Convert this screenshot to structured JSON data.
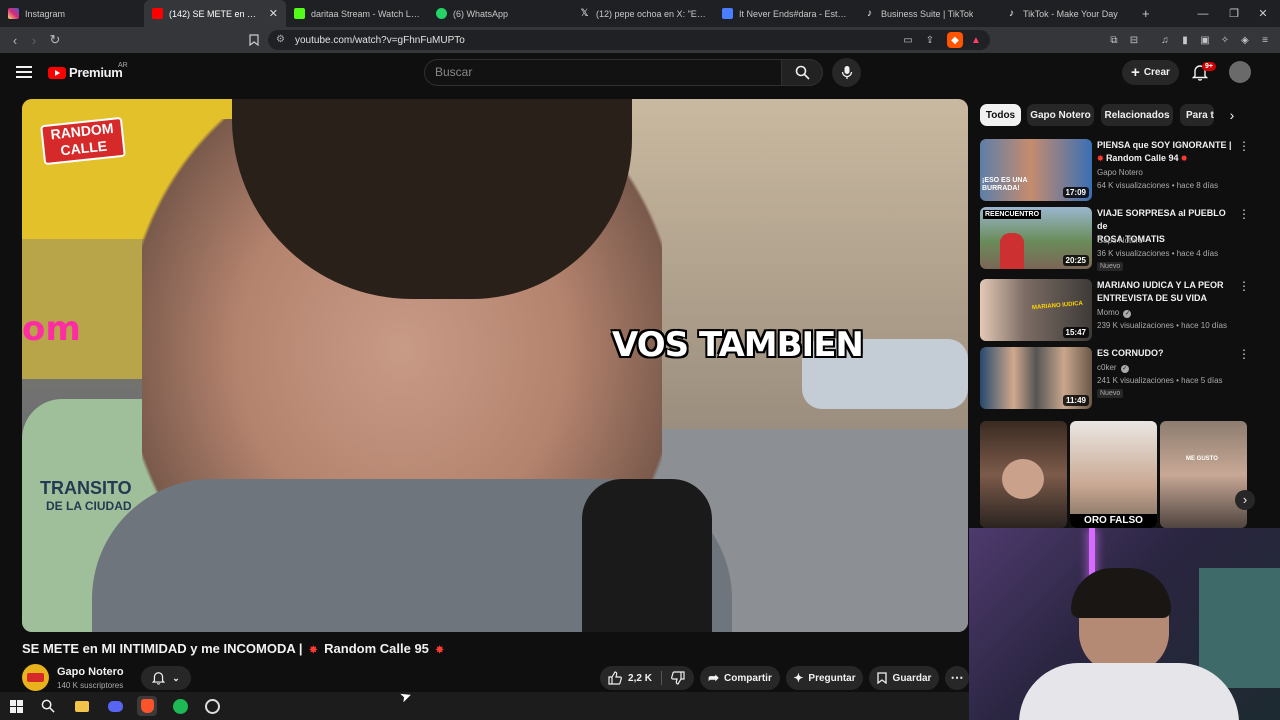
{
  "browser": {
    "tabs": [
      {
        "label": "Instagram",
        "color": "#d62976"
      },
      {
        "label": "(142) SE METE en MI INTIMIDAD",
        "color": "#ff0000",
        "active": true
      },
      {
        "label": "daritaa Stream - Watch Live on",
        "color": "#53fc18"
      },
      {
        "label": "(6) WhatsApp",
        "color": "#25d366"
      },
      {
        "label": "(12) pepe ochoa en X: \"Es el m",
        "color": "#ffffff"
      },
      {
        "label": "It Never Ends#dara - Estadístic",
        "color": "#4a7dff"
      },
      {
        "label": "Business Suite | TikTok",
        "color": "#ffffff"
      },
      {
        "label": "TikTok - Make Your Day",
        "color": "#ffffff"
      }
    ],
    "new_tab": "+",
    "url": "youtube.com/watch?v=gFhnFuMUPTo",
    "brave_badge": "▲"
  },
  "header": {
    "brand": "Premium",
    "region": "AR",
    "search_placeholder": "Buscar",
    "create_label": "Crear",
    "notif_count": "9+"
  },
  "video": {
    "caption": "VOS TAMBIEN",
    "channel_logo_line1": "RANDOM",
    "channel_logo_line2": "CALLE",
    "sign_line1": "TRANSITO",
    "sign_line2": "DE LA CIUDAD",
    "title_main": "SE METE en MI INTIMIDAD y me INCOMODA |",
    "title_series": "Random Calle 95",
    "channel_name": "Gapo Notero",
    "subscribers": "140 K suscriptores",
    "likes": "2,2 K",
    "share_label": "Compartir",
    "ask_label": "Preguntar",
    "save_label": "Guardar"
  },
  "sidebar": {
    "chips": [
      "Todos",
      "Gapo Notero",
      "Relacionados",
      "Para ti"
    ],
    "recommendations": [
      {
        "title_lines": [
          "PIENSA que SOY IGNORANTE |",
          "Random Calle 94"
        ],
        "channel": "Gapo Notero",
        "meta": "64 K visualizaciones • hace 8 días",
        "duration": "17:09",
        "thumb_text": "¡ESO ES UNA BURRADA!",
        "verified": false,
        "is_new": false
      },
      {
        "title_lines": [
          "VIAJE SORPRESA al PUEBLO de",
          "ROSA TOMATIS"
        ],
        "channel": "Gapo Notero",
        "meta": "36 K visualizaciones • hace 4 días",
        "duration": "20:25",
        "thumb_text": "REENCUENTRO",
        "verified": false,
        "is_new": true
      },
      {
        "title_lines": [
          "MARIANO IUDICA Y LA PEOR",
          "ENTREVISTA DE SU VIDA"
        ],
        "channel": "Momo",
        "meta": "239 K visualizaciones • hace 10 días",
        "duration": "15:47",
        "thumb_text": "MARIANO IUDICA",
        "verified": true,
        "is_new": false
      },
      {
        "title_lines": [
          "ES CORNUDO?"
        ],
        "channel": "c0ker",
        "meta": "241 K visualizaciones • hace 5 días",
        "duration": "11:49",
        "thumb_text": "",
        "verified": true,
        "is_new": true
      }
    ],
    "new_label": "Nuevo",
    "shorts": [
      {
        "text": ""
      },
      {
        "text": "ORO FALSO"
      },
      {
        "text": "ME GUSTO"
      }
    ]
  },
  "colors": {
    "accent": "#ff0000",
    "background": "#0f0f0f",
    "surface": "#272727"
  }
}
